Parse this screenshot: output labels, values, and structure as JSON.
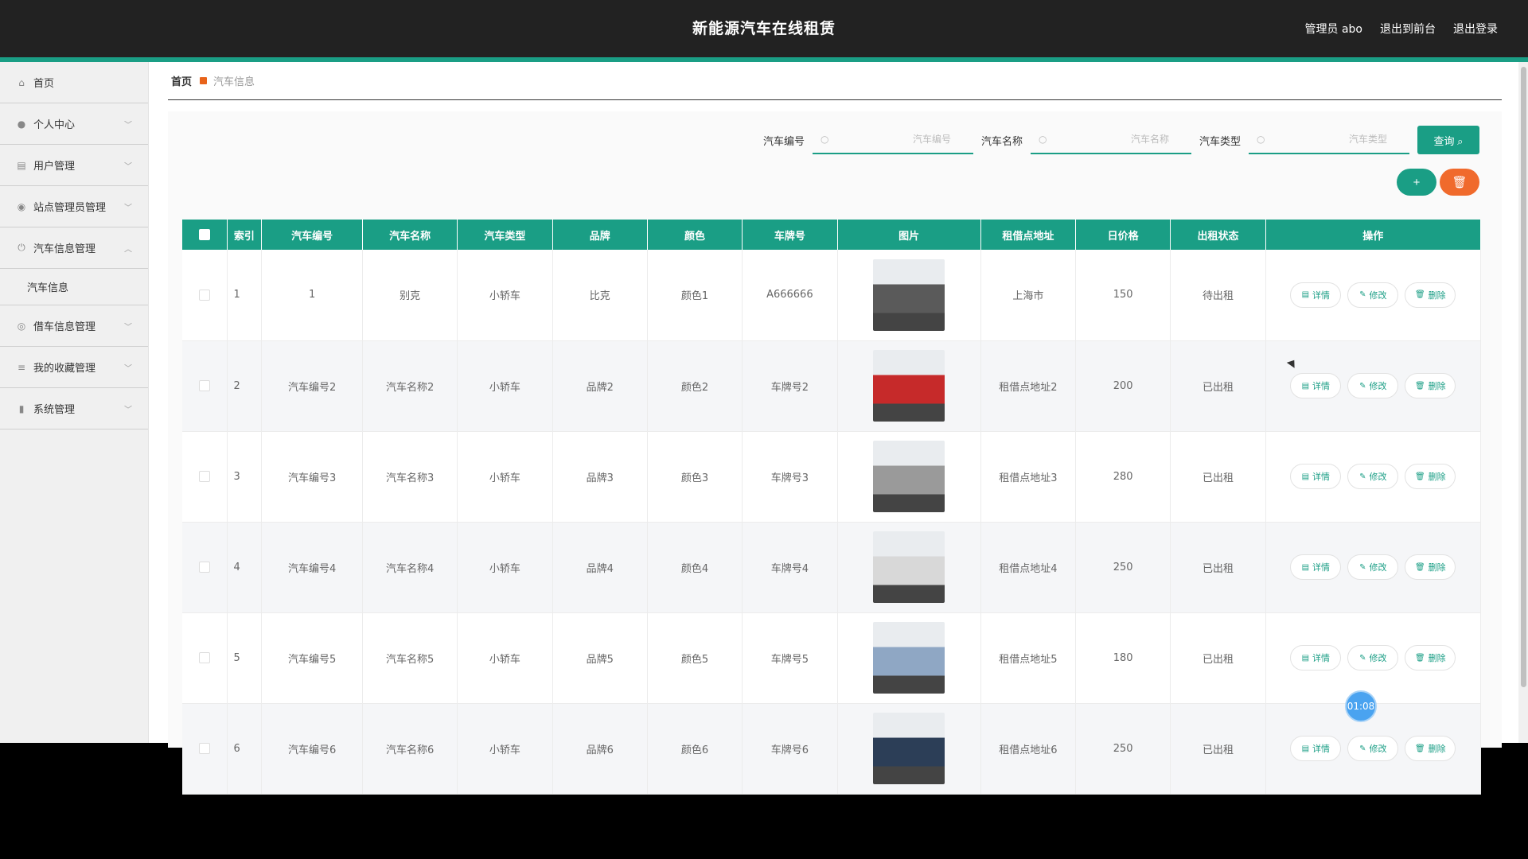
{
  "header": {
    "title": "新能源汽车在线租赁",
    "admin_label": "管理员 abo",
    "back_front": "退出到前台",
    "logout": "退出登录"
  },
  "sidebar": {
    "items": [
      {
        "label": "首页",
        "icon": "home-icon"
      },
      {
        "label": "个人中心",
        "icon": "user-icon"
      },
      {
        "label": "用户管理",
        "icon": "clipboard-icon"
      },
      {
        "label": "站点管理员管理",
        "icon": "location-icon"
      },
      {
        "label": "汽车信息管理",
        "icon": "power-icon",
        "expanded": true,
        "sub": "汽车信息"
      },
      {
        "label": "借车信息管理",
        "icon": "compass-icon"
      },
      {
        "label": "我的收藏管理",
        "icon": "stack-icon"
      },
      {
        "label": "系统管理",
        "icon": "mic-icon"
      }
    ]
  },
  "breadcrumb": {
    "home": "首页",
    "current": "汽车信息"
  },
  "search": {
    "car_no_label": "汽车编号",
    "car_no_placeholder": "汽车编号",
    "car_name_label": "汽车名称",
    "car_name_placeholder": "汽车名称",
    "car_type_label": "汽车类型",
    "car_type_placeholder": "汽车类型",
    "query_label": "查询"
  },
  "actions": {
    "add": "+",
    "delete": "🗑"
  },
  "table": {
    "headers": [
      "索引",
      "汽车编号",
      "汽车名称",
      "汽车类型",
      "品牌",
      "颜色",
      "车牌号",
      "图片",
      "租借点地址",
      "日价格",
      "出租状态",
      "操作"
    ],
    "ops": {
      "detail": "详情",
      "edit": "修改",
      "delete": "删除"
    },
    "rows": [
      {
        "idx": "1",
        "no": "1",
        "name": "别克",
        "type": "小轿车",
        "brand": "比克",
        "color": "颜色1",
        "plate": "A666666",
        "addr": "上海市",
        "price": "150",
        "status": "待出租",
        "img_color": "#5a5a5a"
      },
      {
        "idx": "2",
        "no": "汽车编号2",
        "name": "汽车名称2",
        "type": "小轿车",
        "brand": "品牌2",
        "color": "颜色2",
        "plate": "车牌号2",
        "addr": "租借点地址2",
        "price": "200",
        "status": "已出租",
        "img_color": "#c62a2a"
      },
      {
        "idx": "3",
        "no": "汽车编号3",
        "name": "汽车名称3",
        "type": "小轿车",
        "brand": "品牌3",
        "color": "颜色3",
        "plate": "车牌号3",
        "addr": "租借点地址3",
        "price": "280",
        "status": "已出租",
        "img_color": "#9a9a9a"
      },
      {
        "idx": "4",
        "no": "汽车编号4",
        "name": "汽车名称4",
        "type": "小轿车",
        "brand": "品牌4",
        "color": "颜色4",
        "plate": "车牌号4",
        "addr": "租借点地址4",
        "price": "250",
        "status": "已出租",
        "img_color": "#d8d8d8"
      },
      {
        "idx": "5",
        "no": "汽车编号5",
        "name": "汽车名称5",
        "type": "小轿车",
        "brand": "品牌5",
        "color": "颜色5",
        "plate": "车牌号5",
        "addr": "租借点地址5",
        "price": "180",
        "status": "已出租",
        "img_color": "#8fa7c4"
      },
      {
        "idx": "6",
        "no": "汽车编号6",
        "name": "汽车名称6",
        "type": "小轿车",
        "brand": "品牌6",
        "color": "颜色6",
        "plate": "车牌号6",
        "addr": "租借点地址6",
        "price": "250",
        "status": "已出租",
        "img_color": "#2c3e57"
      }
    ]
  },
  "timer": "01:08",
  "colors": {
    "accent": "#1a9e85",
    "danger": "#f06a2c",
    "topbar": "#222222"
  }
}
